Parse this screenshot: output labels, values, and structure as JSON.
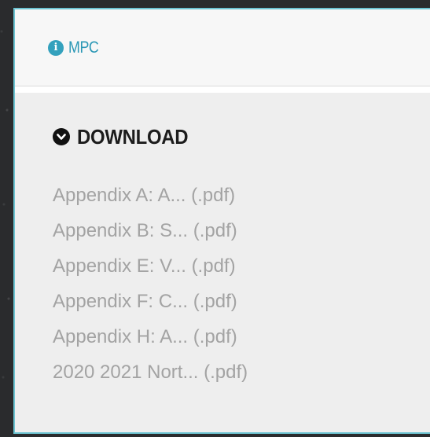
{
  "header": {
    "icon": "info-circle-icon",
    "title": "MPC"
  },
  "download": {
    "icon": "chevron-down-circle-icon",
    "label": "DOWNLOAD"
  },
  "files": [
    {
      "label": "Appendix A: A... (.pdf)"
    },
    {
      "label": "Appendix B: S... (.pdf)"
    },
    {
      "label": "Appendix E: V... (.pdf)"
    },
    {
      "label": "Appendix F: C... (.pdf)"
    },
    {
      "label": "Appendix H: A... (.pdf)"
    },
    {
      "label": "2020 2021 Nort... (.pdf)"
    }
  ],
  "colors": {
    "accent": "#34a1bd",
    "border": "#6cc3d1",
    "link_text": "#a3a3a3",
    "background": "#2a2b2d"
  }
}
